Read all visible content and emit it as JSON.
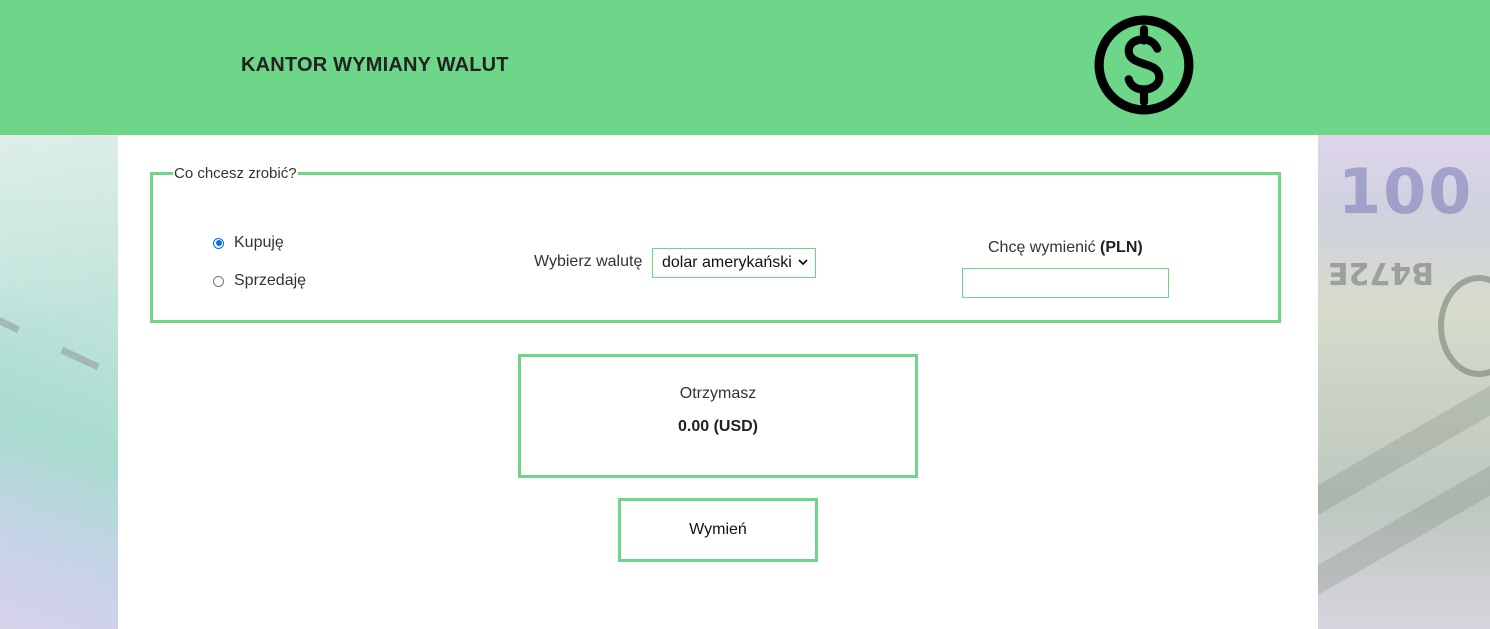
{
  "header": {
    "title": "KANTOR WYMIANY WALUT",
    "logo_icon": "dollar-circle-icon",
    "background_color": "#6dd689"
  },
  "form": {
    "legend": "Co chcesz zrobić?",
    "options": [
      {
        "label": "Kupuję",
        "checked": true
      },
      {
        "label": "Sprzedaję",
        "checked": false
      }
    ],
    "currency_label": "Wybierz walutę",
    "currency_selected": "dolar amerykański",
    "amount_label_prefix": "Chcę wymienić",
    "amount_label_unit": "(PLN)",
    "amount_value": ""
  },
  "result": {
    "label": "Otrzymasz",
    "value": "0.00 (USD)"
  },
  "actions": {
    "exchange_label": "Wymień"
  },
  "colors": {
    "accent": "#6dd689",
    "radio_checked": "#0b6ee8"
  }
}
